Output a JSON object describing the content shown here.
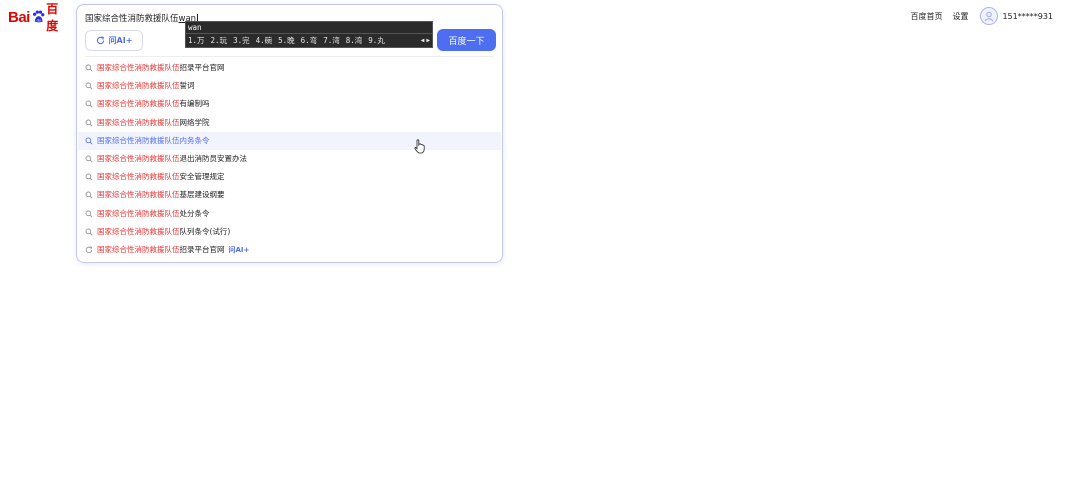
{
  "logo": {
    "text_en": "Bai",
    "text_cn": "百度"
  },
  "topnav": {
    "home": "百度首页",
    "settings": "设置",
    "username": "151*****931"
  },
  "search": {
    "query_committed": "国家综合性消防救援队伍",
    "query_composing": "wan",
    "ai_chip_label": "问AI+",
    "button_label": "百度一下"
  },
  "ime": {
    "pinyin": "wan",
    "candidates": [
      "1.万",
      "2.玩",
      "3.完",
      "4.碗",
      "5.晚",
      "6.弯",
      "7.湾",
      "8.湾",
      "9.丸"
    ]
  },
  "suggestions": {
    "prefix": "国家综合性消防救援队伍",
    "items": [
      {
        "rest": "招录平台官网"
      },
      {
        "rest": "誓词"
      },
      {
        "rest": "有编制吗"
      },
      {
        "rest": "网络学院"
      },
      {
        "rest": "内务条令"
      },
      {
        "rest": "退出消防员安置办法"
      },
      {
        "rest": "安全管理规定"
      },
      {
        "rest": "基层建设纲要"
      },
      {
        "rest": "处分条令"
      },
      {
        "rest": "队列条令(试行)"
      },
      {
        "rest": "招录平台官网",
        "tag": "问AI+"
      }
    ]
  }
}
